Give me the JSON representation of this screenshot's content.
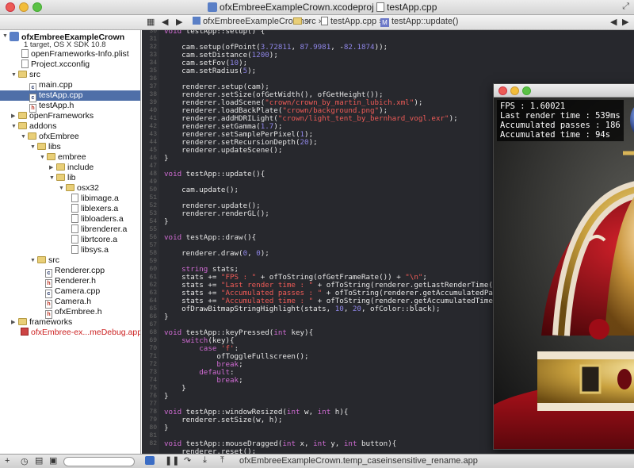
{
  "title": {
    "project": "ofxEmbreeExampleCrown.xcodeproj",
    "file": "testApp.cpp"
  },
  "nav": {
    "crumbs": [
      "ofxEmbreeExampleCrown",
      "src",
      "testApp.cpp",
      "testApp::update()"
    ]
  },
  "sidebar": {
    "project_name": "ofxEmbreeExampleCrown",
    "project_sub": "1 target, OS X SDK 10.8",
    "items": [
      {
        "label": "openFrameworks-Info.plist"
      },
      {
        "label": "Project.xcconfig"
      },
      {
        "label": "src"
      },
      {
        "label": "main.cpp"
      },
      {
        "label": "testApp.cpp"
      },
      {
        "label": "testApp.h"
      },
      {
        "label": "openFrameworks"
      },
      {
        "label": "addons"
      },
      {
        "label": "ofxEmbree"
      },
      {
        "label": "libs"
      },
      {
        "label": "embree"
      },
      {
        "label": "include"
      },
      {
        "label": "lib"
      },
      {
        "label": "osx32"
      },
      {
        "label": "libimage.a"
      },
      {
        "label": "liblexers.a"
      },
      {
        "label": "libloaders.a"
      },
      {
        "label": "librenderer.a"
      },
      {
        "label": "librtcore.a"
      },
      {
        "label": "libsys.a"
      },
      {
        "label": "src"
      },
      {
        "label": "Renderer.cpp"
      },
      {
        "label": "Renderer.h"
      },
      {
        "label": "Camera.cpp"
      },
      {
        "label": "Camera.h"
      },
      {
        "label": "ofxEmbree.h"
      },
      {
        "label": "frameworks"
      },
      {
        "label": "ofxEmbree-ex...meDebug.app"
      }
    ]
  },
  "editor": {
    "line_numbers": [
      "30",
      "31",
      "32",
      "33",
      "34",
      "35",
      "36",
      "37",
      "38",
      "39",
      "40",
      "41",
      "42",
      "43",
      "44",
      "45",
      "46",
      "47",
      "48",
      "49",
      "50",
      "51",
      "52",
      "53",
      "54",
      "55",
      "56",
      "57",
      "58",
      "59",
      "60",
      "61",
      "62",
      "63",
      "64",
      "65",
      "66",
      "67",
      "68",
      "69",
      "70",
      "71",
      "72",
      "73",
      "74",
      "75",
      "76",
      "77",
      "78",
      "79",
      "80",
      "81",
      "82"
    ],
    "lines": [
      "void testApp::setup() {",
      "",
      "    cam.setup(ofPoint(3.72811, 87.9981, -82.1874));",
      "    cam.setDistance(1200);",
      "    cam.setFov(10);",
      "    cam.setRadius(5);",
      "",
      "    renderer.setup(cam);",
      "    renderer.setSize(ofGetWidth(), ofGetHeight());",
      "    renderer.loadScene(\"crown/crown_by_martin_lubich.xml\");",
      "    renderer.loadBackPlate(\"crown/background.png\");",
      "    renderer.addHDRILight(\"crown/light_tent_by_bernhard_vogl.exr\");",
      "    renderer.setGamma(1.7);",
      "    renderer.setSamplePerPixel(1);",
      "    renderer.setRecursionDepth(20);",
      "    renderer.updateScene();",
      "}",
      "",
      "void testApp::update(){",
      "",
      "    cam.update();",
      "",
      "    renderer.update();",
      "    renderer.renderGL();",
      "}",
      "",
      "void testApp::draw(){",
      "",
      "    renderer.draw(0, 0);",
      "",
      "    string stats;",
      "    stats += \"FPS : \" + ofToString(ofGetFrameRate()) + \"\\n\";",
      "    stats += \"Last render time : \" + ofToString(renderer.getLastRenderTime()) + \"\\n\";",
      "    stats += \"Accumulated passes : \" + ofToString(renderer.getAccumulatedPasses()) + \"\\n\";",
      "    stats += \"Accumulated time : \" + ofToString(renderer.getAccumulatedTime()) + \"\\n\";",
      "    ofDrawBitmapStringHighlight(stats, 10, 20, ofColor::black);",
      "}",
      "",
      "void testApp::keyPressed(int key){",
      "    switch(key){",
      "        case 'f':",
      "            ofToggleFullscreen();",
      "            break;",
      "        default:",
      "            break;",
      "    }",
      "}",
      "",
      "void testApp::windowResized(int w, int h){",
      "    renderer.setSize(w, h);",
      "}",
      "",
      "void testApp::mouseDragged(int x, int y, int button){",
      "    renderer.reset();",
      "}"
    ]
  },
  "render_window": {
    "stats": "FPS : 1.60021\nLast render time : 539ms\nAccumulated passes : 186\nAccumulated time : 94s"
  },
  "statusbar": {
    "text": "ofxEmbreeExampleCrown.temp_caseinsensitive_rename.app"
  },
  "colors": {
    "selection": "#4f6fa8",
    "editor_bg": "#27282d",
    "keyword": "#d06bd3",
    "string": "#ef5b57",
    "number": "#8f86e8"
  }
}
